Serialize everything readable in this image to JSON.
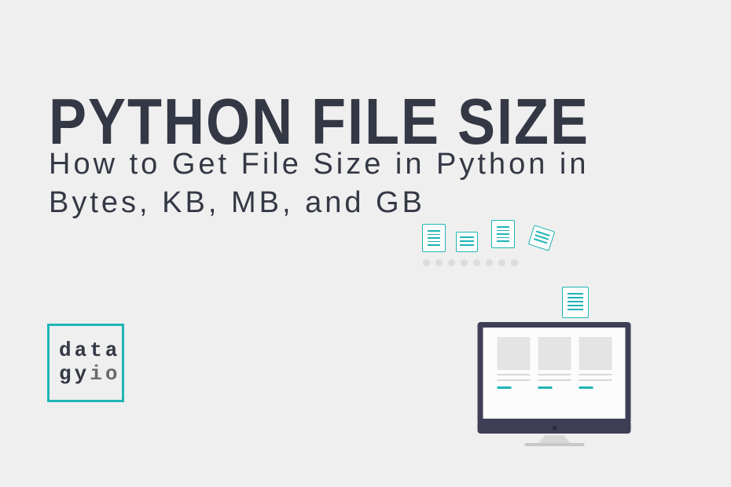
{
  "title": "PYTHON FILE SIZE",
  "subtitle": "How to Get File Size in Python in Bytes, KB, MB, and GB",
  "logo": {
    "line1": "data",
    "line2_a": "gy",
    "line2_b": "io"
  }
}
